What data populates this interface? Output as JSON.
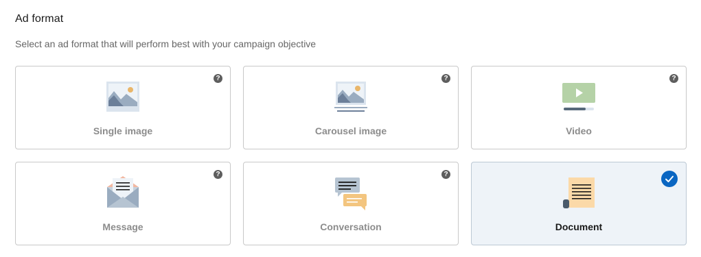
{
  "header": {
    "title": "Ad format",
    "subtitle": "Select an ad format that will perform best with your campaign objective"
  },
  "formats": [
    {
      "label": "Single image",
      "icon": "single-image-icon",
      "has_help": true,
      "selected": false
    },
    {
      "label": "Carousel image",
      "icon": "carousel-image-icon",
      "has_help": true,
      "selected": false
    },
    {
      "label": "Video",
      "icon": "video-icon",
      "has_help": true,
      "selected": false
    },
    {
      "label": "Message",
      "icon": "message-icon",
      "has_help": true,
      "selected": false
    },
    {
      "label": "Conversation",
      "icon": "conversation-icon",
      "has_help": true,
      "selected": false
    },
    {
      "label": "Document",
      "icon": "document-icon",
      "has_help": false,
      "selected": true
    }
  ],
  "help_glyph": "?",
  "colors": {
    "selected_bg": "#eef3f8",
    "check_blue": "#0a66c2",
    "border": "#c8c8c8"
  }
}
